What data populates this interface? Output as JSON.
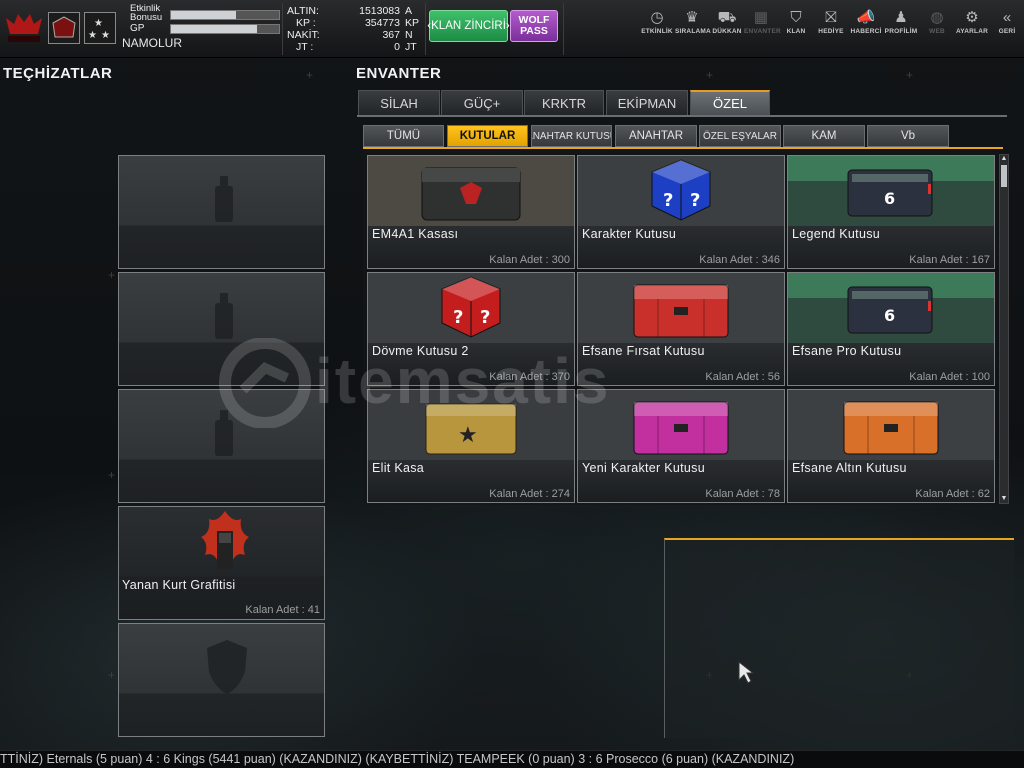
{
  "player": {
    "etkinlik_label": "Etkinlik Bonusu",
    "etkinlik_fill": 0.6,
    "gp_label": "GP",
    "gp_fill": 0.8,
    "name": "NAMOLUR"
  },
  "currencies": [
    {
      "label": "ALTIN:",
      "value": "1513083",
      "unit": "A"
    },
    {
      "label": "KP :",
      "value": "354773",
      "unit": "KP"
    },
    {
      "label": "NAKİT:",
      "value": "367",
      "unit": "N"
    },
    {
      "label": "JT :",
      "value": "0",
      "unit": "JT"
    }
  ],
  "buttons": {
    "klan_zinciri": "‹KLAN ZİNCİRİ›",
    "wolf_pass": "WOLF PASS"
  },
  "nav": [
    {
      "icon": "clock-icon",
      "glyph": "◷",
      "label": "ETKİNLİK",
      "enabled": true
    },
    {
      "icon": "ranking-badge-icon",
      "glyph": "♛",
      "label": "SIRALAMA",
      "enabled": true
    },
    {
      "icon": "cart-icon",
      "glyph": "⛟",
      "label": "DÜKKAN",
      "enabled": true
    },
    {
      "icon": "inventory-icon",
      "glyph": "▦",
      "label": "ENVANTER",
      "enabled": false
    },
    {
      "icon": "clan-shield-icon",
      "glyph": "⛉",
      "label": "KLAN",
      "enabled": true
    },
    {
      "icon": "gift-icon",
      "glyph": "⛝",
      "label": "HEDİYE",
      "enabled": true
    },
    {
      "icon": "megaphone-icon",
      "glyph": "📣",
      "label": "HABERCİ",
      "enabled": true
    },
    {
      "icon": "profile-icon",
      "glyph": "♟",
      "label": "PROFİLİM",
      "enabled": true
    },
    {
      "icon": "web-globe-icon",
      "glyph": "◍",
      "label": "WEB",
      "enabled": false
    },
    {
      "icon": "gear-icon",
      "glyph": "⚙",
      "label": "AYARLAR",
      "enabled": true
    },
    {
      "icon": "back-chevrons-icon",
      "glyph": "«",
      "label": "GERİ",
      "enabled": true
    }
  ],
  "headings": {
    "equipment": "TEÇHİZATLAR",
    "inventory": "ENVANTER"
  },
  "tabs": [
    "SİLAH",
    "GÜÇ+",
    "KRKTR",
    "EKİPMAN",
    "ÖZEL"
  ],
  "active_tab": "ÖZEL",
  "subtabs": [
    "TÜMÜ",
    "KUTULAR",
    "ANAHTAR KUTUSU",
    "ANAHTAR",
    "ÖZEL EŞYALAR",
    "KAM",
    "Vb"
  ],
  "active_subtab": "KUTULAR",
  "count_label": "Kalan Adet :",
  "items": [
    {
      "name": "EM4A1 Kasası",
      "count": "300",
      "art": "dark-crate",
      "color": "#3a3a3a"
    },
    {
      "name": "Karakter Kutusu",
      "count": "346",
      "art": "mystery-cube",
      "color": "#1d3fc4"
    },
    {
      "name": "Legend Kutusu",
      "count": "167",
      "art": "number-crate",
      "color": "#2c3140"
    },
    {
      "name": "Dövme Kutusu 2",
      "count": "370",
      "art": "mystery-cube",
      "color": "#c41d1d"
    },
    {
      "name": "Efsane Fırsat Kutusu",
      "count": "56",
      "art": "color-crate",
      "color": "#c9302c"
    },
    {
      "name": "Efsane Pro Kutusu",
      "count": "100",
      "art": "number-crate",
      "color": "#2c3140"
    },
    {
      "name": "Elit Kasa",
      "count": "274",
      "art": "star-crate",
      "color": "#b8963e"
    },
    {
      "name": "Yeni Karakter Kutusu",
      "count": "78",
      "art": "color-crate",
      "color": "#c2309f"
    },
    {
      "name": "Efsane Altın Kutusu",
      "count": "62",
      "art": "color-crate",
      "color": "#d9702a"
    }
  ],
  "equipment_slots": [
    {
      "type": "spray-can-icon",
      "name": "",
      "count": ""
    },
    {
      "type": "spray-can-icon",
      "name": "",
      "count": ""
    },
    {
      "type": "spray-can-icon",
      "name": "",
      "count": ""
    },
    {
      "type": "burning-wolf-graffiti",
      "name": "Yanan Kurt Grafitisi",
      "count": "41"
    },
    {
      "type": "shield-icon",
      "name": "",
      "count": ""
    }
  ],
  "watermark": "itemsatis",
  "ticker": "TTİNİZ) Eternals (5 puan) 4 : 6 Kings (5441 puan) (KAZANDINIZ)          (KAYBETTİNİZ) TEAMPEEK (0 puan) 3 : 6 Prosecco (6 puan) (KAZANDINIZ)"
}
